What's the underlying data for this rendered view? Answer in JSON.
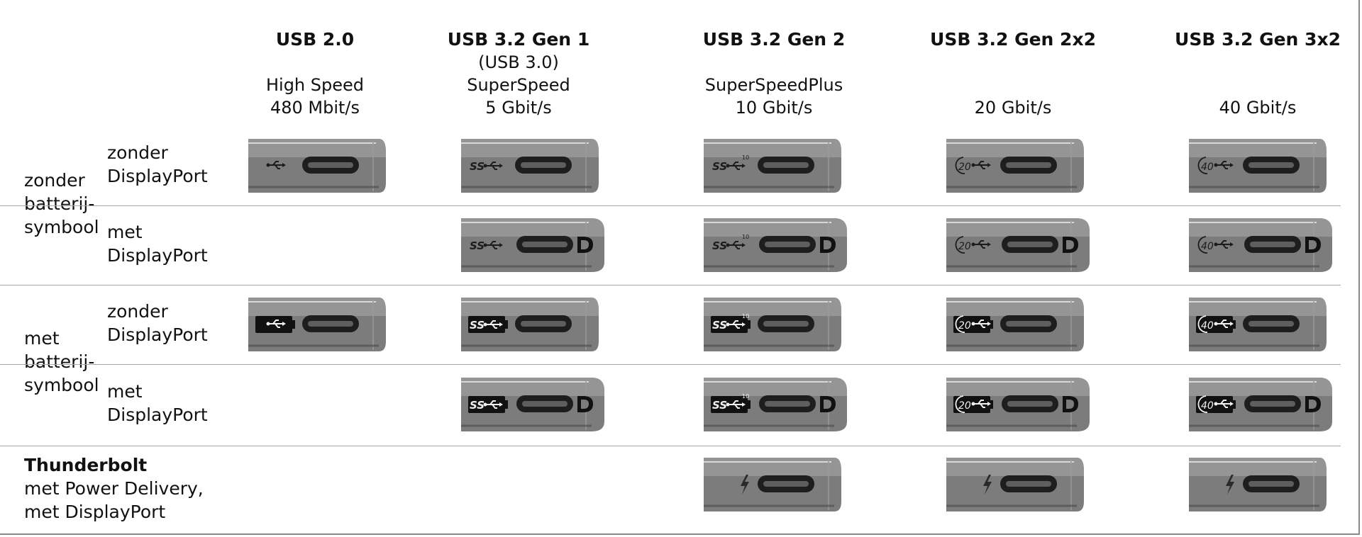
{
  "columns": [
    {
      "key": "usb20",
      "title": "USB 2.0",
      "subtitle": "",
      "name": "High Speed",
      "speed": "480 Mbit/s"
    },
    {
      "key": "gen1",
      "title": "USB 3.2 Gen 1",
      "subtitle": "(USB 3.0)",
      "name": "SuperSpeed",
      "speed": "5 Gbit/s"
    },
    {
      "key": "gen2",
      "title": "USB 3.2 Gen 2",
      "subtitle": "",
      "name": "SuperSpeedPlus",
      "speed": "10 Gbit/s"
    },
    {
      "key": "gen2x2",
      "title": "USB 3.2 Gen 2x2",
      "subtitle": "",
      "name": "",
      "speed": "20 Gbit/s"
    },
    {
      "key": "gen3x2",
      "title": "USB 3.2 Gen 3x2",
      "subtitle": "",
      "name": "",
      "speed": "40 Gbit/s"
    }
  ],
  "groups": [
    {
      "key": "no_battery",
      "label_lines": [
        "zonder",
        "batterij-",
        "symbool"
      ]
    },
    {
      "key": "battery",
      "label_lines": [
        "met",
        "batterij-",
        "symbool"
      ]
    }
  ],
  "rows": [
    {
      "group": "no_battery",
      "label_lines": [
        "zonder",
        "DisplayPort"
      ],
      "displayport": false,
      "battery": false,
      "ports": [
        "usb",
        "ss",
        "ss10",
        "20",
        "40"
      ]
    },
    {
      "group": "no_battery",
      "label_lines": [
        "met",
        "DisplayPort"
      ],
      "displayport": true,
      "battery": false,
      "ports": [
        null,
        "ss",
        "ss10",
        "20",
        "40"
      ]
    },
    {
      "group": "battery",
      "label_lines": [
        "zonder",
        "DisplayPort"
      ],
      "displayport": false,
      "battery": true,
      "ports": [
        "usb",
        "ss",
        "ss10",
        "20",
        "40"
      ]
    },
    {
      "group": "battery",
      "label_lines": [
        "met",
        "DisplayPort"
      ],
      "displayport": true,
      "battery": true,
      "ports": [
        null,
        "ss",
        "ss10",
        "20",
        "40"
      ]
    }
  ],
  "thunderbolt": {
    "title": "Thunderbolt",
    "line2": "met Power Delivery,",
    "line3": "met DisplayPort",
    "ports": [
      null,
      null,
      "tb",
      "tb",
      "tb"
    ]
  },
  "logo_text": {
    "ss": "SS",
    "ss10_super": "10",
    "g20": "20",
    "g40": "40"
  },
  "colors": {
    "port_body": "#7c7c7c",
    "port_dark": "#4a4a4a",
    "socket": "#1e1e1e",
    "line": "#a8a8a8"
  }
}
